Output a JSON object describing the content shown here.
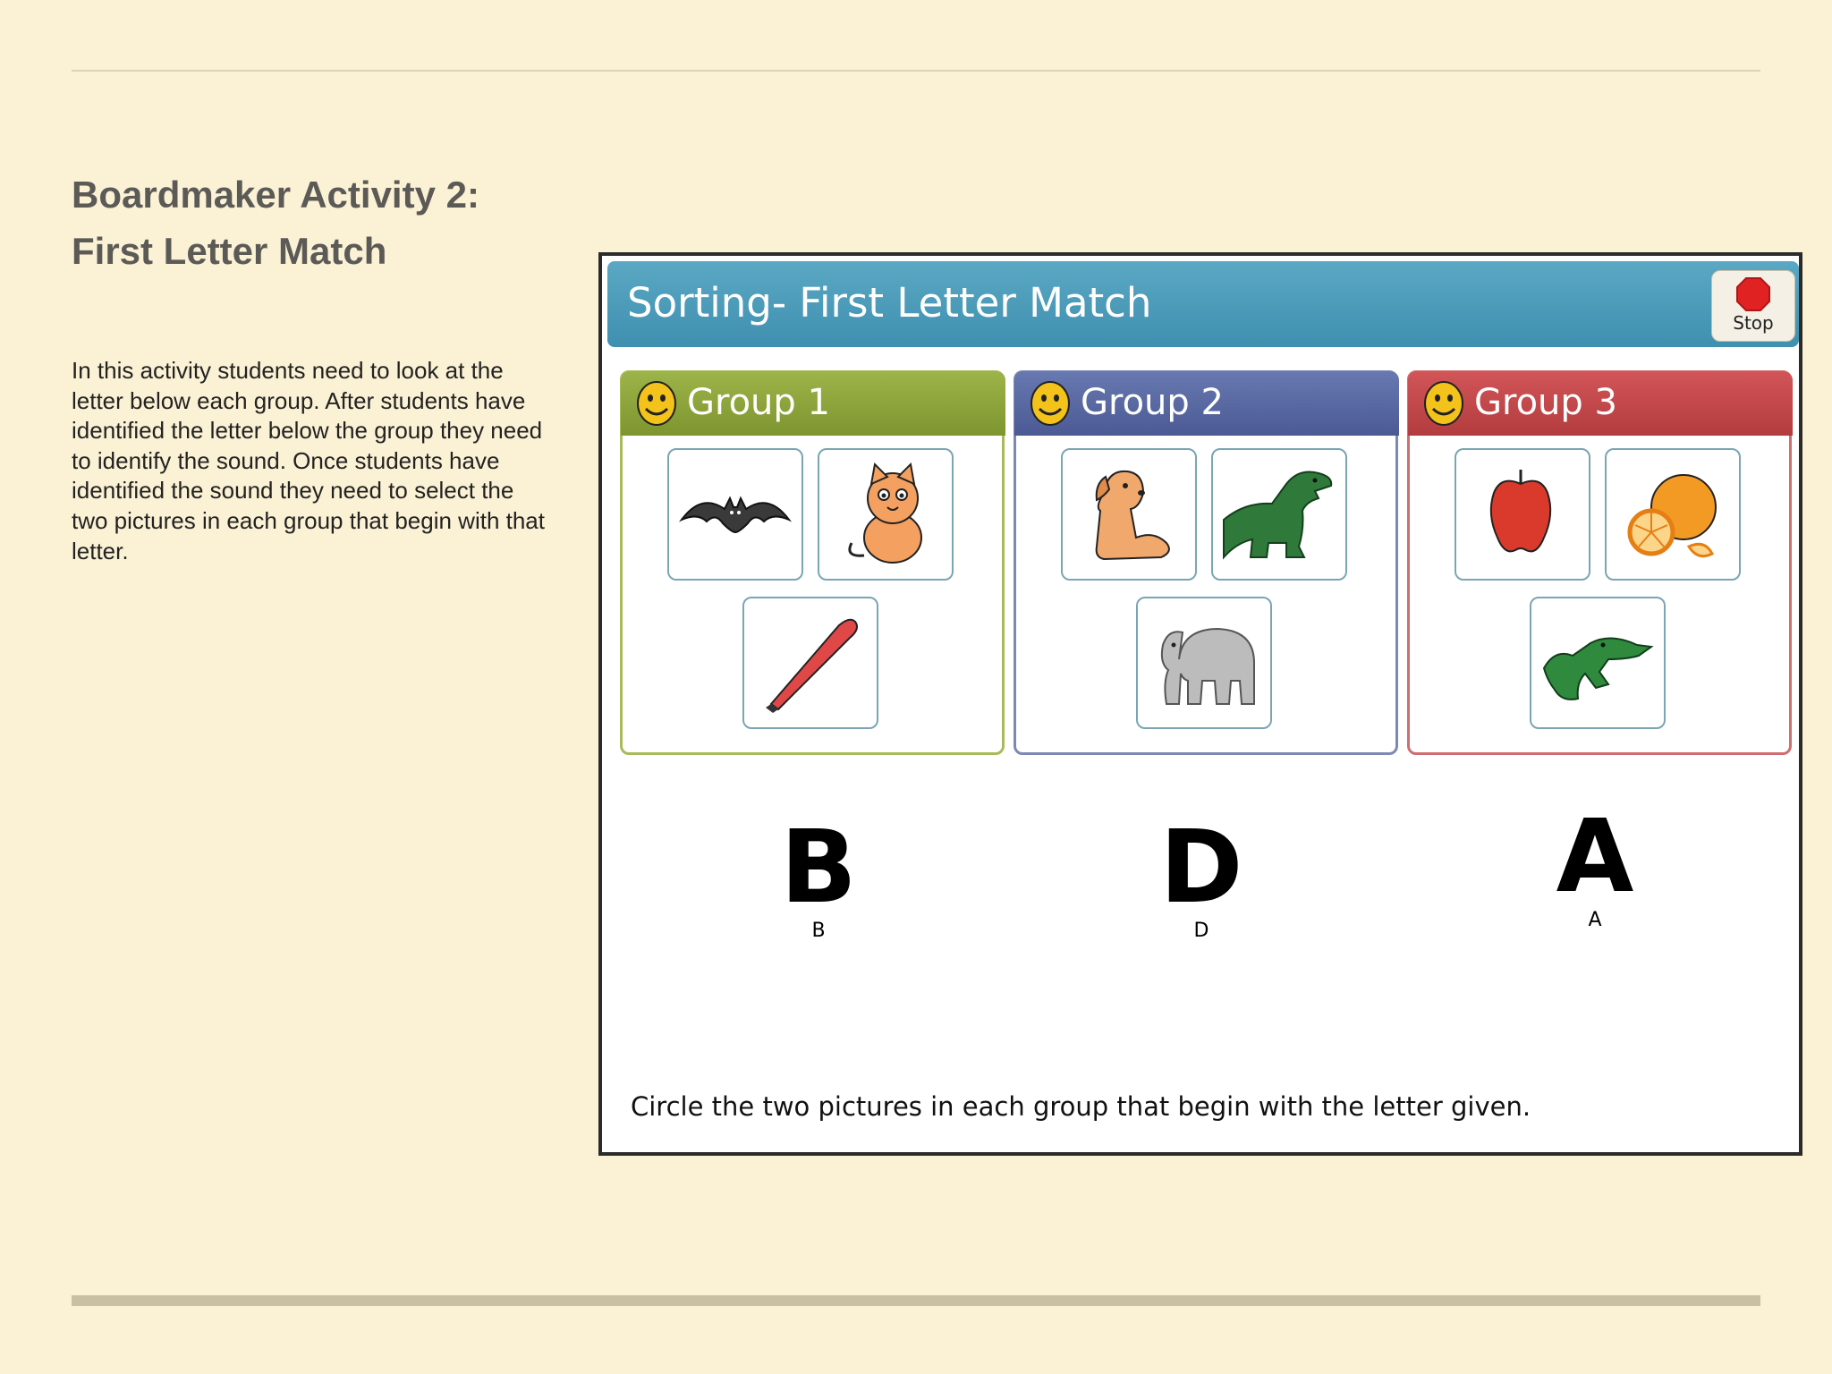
{
  "slide": {
    "title_line1": "Boardmaker Activity 2:",
    "title_line2": "First Letter Match",
    "description": "In this activity students need to look at the letter below each group. After students have identified the letter below the group they need to identify the sound. Once students have identified the sound they need to select the two pictures in each group that begin with that letter."
  },
  "activity": {
    "title": "Sorting- First Letter Match",
    "stop_label": "Stop",
    "instruction": "Circle the two pictures in each group that begin with the letter given.",
    "groups": [
      {
        "label": "Group 1",
        "color": "#8ba23a",
        "pictures": [
          "bat-icon",
          "cat-icon",
          "baseball-bat-icon"
        ],
        "letter": "B",
        "letter_caption": "B"
      },
      {
        "label": "Group 2",
        "color": "#5566a0",
        "pictures": [
          "dog-icon",
          "dinosaur-icon",
          "elephant-icon"
        ],
        "letter": "D",
        "letter_caption": "D"
      },
      {
        "label": "Group 3",
        "color": "#c4484a",
        "pictures": [
          "apple-icon",
          "orange-icon",
          "alligator-icon"
        ],
        "letter": "A",
        "letter_caption": "A"
      }
    ]
  }
}
